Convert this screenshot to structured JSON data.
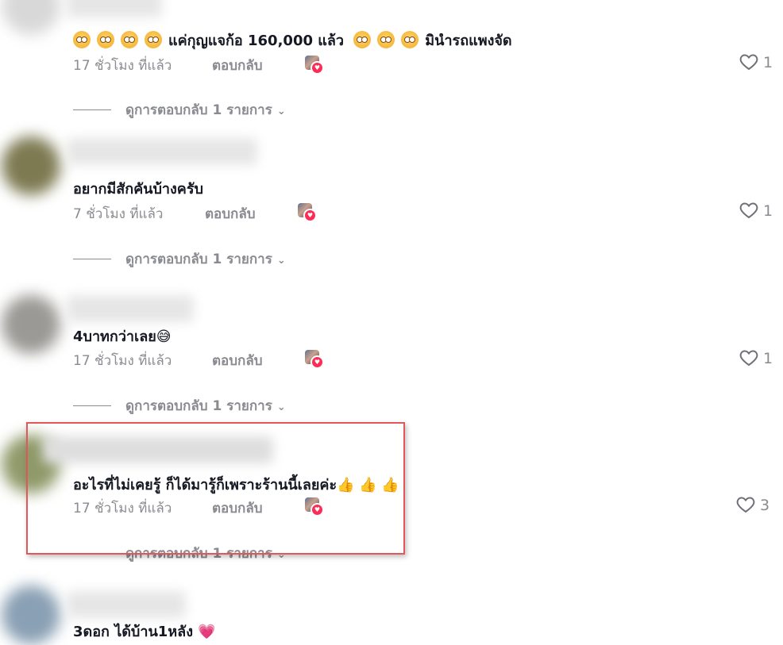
{
  "comments": [
    {
      "text_prefix": "แค่กุญแจก้อ 160,000 แล้ว",
      "text_suffix": "มินำรถแพงจัด",
      "time": "17 ชั่วโมง ที่แล้ว",
      "reply_label": "ตอบกลับ",
      "likes": "1",
      "view_replies": "ดูการตอบกลับ 1 รายการ"
    },
    {
      "text": "อยากมีสักคันบ้างครับ",
      "time": "7 ชั่วโมง ที่แล้ว",
      "reply_label": "ตอบกลับ",
      "likes": "1",
      "view_replies": "ดูการตอบกลับ 1 รายการ"
    },
    {
      "text": "4บาทกว่าเลย",
      "text_emoji": "😅",
      "time": "17 ชั่วโมง ที่แล้ว",
      "reply_label": "ตอบกลับ",
      "likes": "1",
      "view_replies": "ดูการตอบกลับ 1 รายการ"
    },
    {
      "text": "อะไรที่ไม่เคยรู้ ก็ได้มารู้ก็เพราะร้านนี้เลยค่ะ",
      "text_emoji": "👍 👍 👍",
      "time": "17 ชั่วโมง ที่แล้ว",
      "reply_label": "ตอบกลับ",
      "likes": "3",
      "view_replies": "ดูการตอบกลับ 1 รายการ"
    },
    {
      "text": "3ดอก ได้บ้าน1หลัง",
      "text_emoji": "💗"
    }
  ],
  "colors": {
    "highlight_border": "#e2575a",
    "meta_text": "#8a8b91",
    "creator_heart_badge": "#fe2c55"
  },
  "icons": {
    "like": "heart-outline-icon",
    "creator_liked": "creator-liked-badge-icon",
    "expand": "chevron-down-icon"
  }
}
